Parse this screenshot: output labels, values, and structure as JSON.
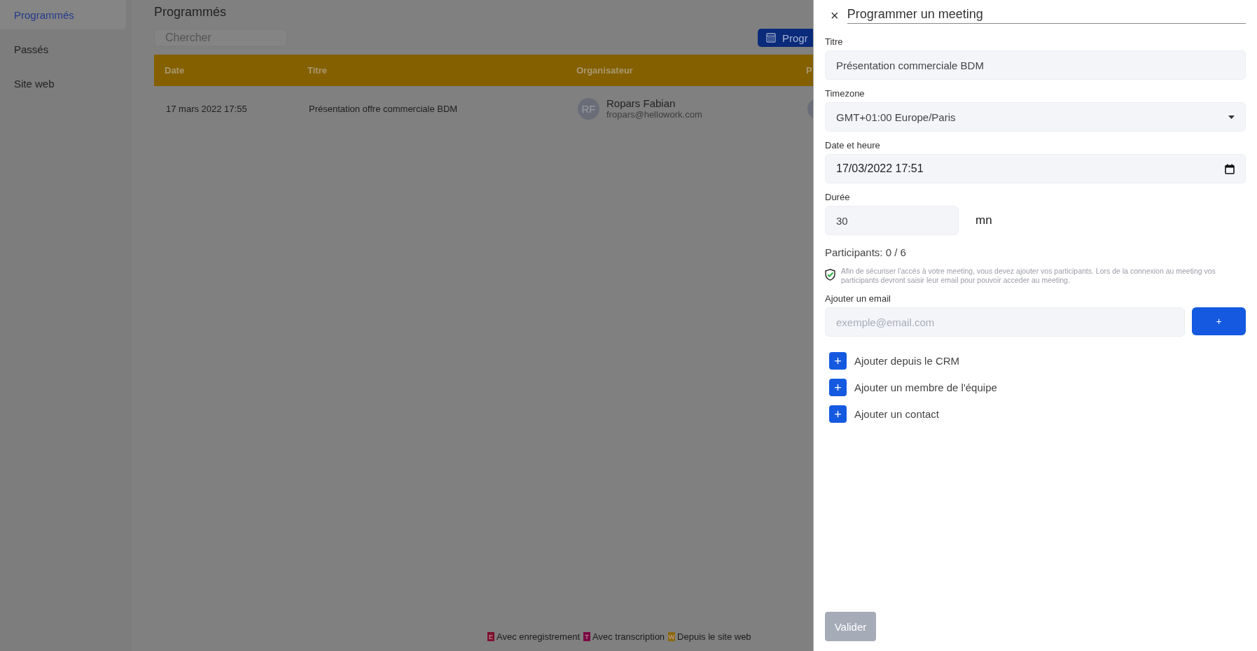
{
  "sidebar": {
    "items": [
      {
        "label": "Programmés",
        "selected": true
      },
      {
        "label": "Passés",
        "selected": false
      },
      {
        "label": "Site web",
        "selected": false
      }
    ]
  },
  "main": {
    "title": "Programmés",
    "search": {
      "placeholder": "Chercher"
    },
    "action_button": "Progr",
    "table": {
      "columns": [
        "Date",
        "Titre",
        "Organisateur",
        "P"
      ],
      "rows": [
        {
          "date": "17 mars 2022 17:55",
          "title": "Présentation offre commerciale BDM",
          "organizer": {
            "initials": "RF",
            "name": "Ropars Fabian",
            "email": "fropars@hellowork.com"
          }
        }
      ]
    },
    "legend": [
      {
        "badge": "E",
        "label": "Avec enregistrement",
        "color": "#7a1030"
      },
      {
        "badge": "T",
        "label": "Avec transcription",
        "color": "#7a0a45"
      },
      {
        "badge": "W",
        "label": "Depuis le site web",
        "color": "#8a6a10"
      }
    ]
  },
  "panel": {
    "close": "×",
    "title": "Programmer un meeting",
    "title_field": {
      "label": "Titre",
      "value": "Présentation commerciale BDM"
    },
    "timezone": {
      "label": "Timezone",
      "value": "GMT+01:00 Europe/Paris"
    },
    "datetime": {
      "label": "Date et heure",
      "value": "17/03/2022 17:51"
    },
    "duration": {
      "label": "Durée",
      "value": "30",
      "unit": "mn"
    },
    "participants": "Participants: 0 / 6",
    "notice": "Afin de sécuriser l'accés à votre meeting, vous devez ajouter vos participants. Lors de la connexion au meeting vos participants devront saisir leur email pour pouvoir acceder au meeting.",
    "email": {
      "label": "Ajouter un email",
      "placeholder": "exemple@email.com",
      "button": "+"
    },
    "add_options": [
      {
        "icon": "+",
        "label": "Ajouter depuis le CRM"
      },
      {
        "icon": "+",
        "label": "Ajouter un membre de l'équipe"
      },
      {
        "icon": "+",
        "label": "Ajouter un contact"
      }
    ],
    "submit": {
      "label": "Valider",
      "disabled": true
    }
  }
}
